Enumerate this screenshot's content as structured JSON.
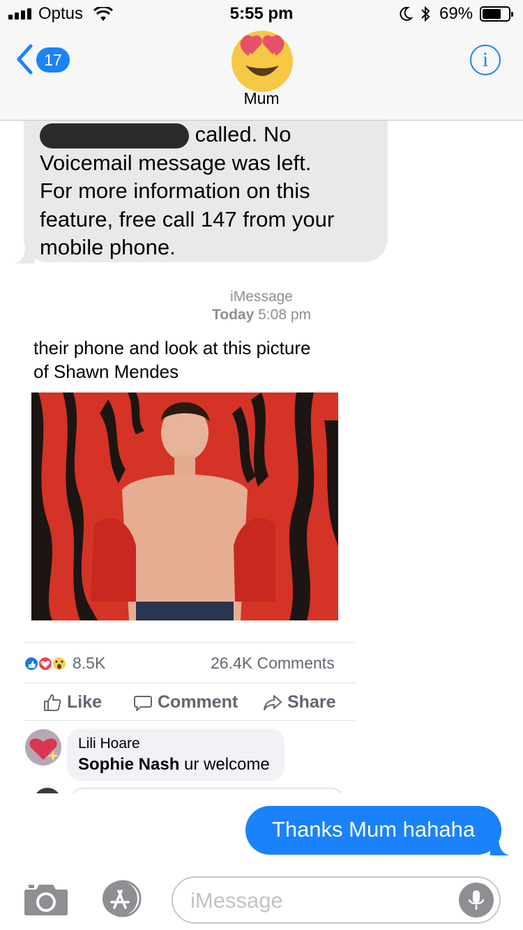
{
  "status_bar": {
    "carrier": "Optus",
    "time": "5:55 pm",
    "battery_percent": "69%",
    "icons": [
      "signal-icon",
      "wifi-icon",
      "moon-icon",
      "bluetooth-icon",
      "battery-icon"
    ]
  },
  "header": {
    "back_count": "17",
    "contact_name": "Mum",
    "contact_avatar": "heart-eyes-emoji",
    "info_label": "i"
  },
  "conversation": {
    "incoming_message": {
      "line1_suffix": "called. No",
      "line2": "Voicemail message was left.",
      "line3": "For more information on this",
      "line4": "feature, free call 147 from your",
      "line5": "mobile phone."
    },
    "divider": {
      "service": "iMessage",
      "day": "Today",
      "time": "5:08 pm"
    },
    "screenshot_post": {
      "text_line1": "their phone and look at this picture",
      "text_line2": "of Shawn Mendes",
      "reactions_count": "8.5K",
      "comments_count": "26.4K Comments",
      "actions": {
        "like": "Like",
        "comment": "Comment",
        "share": "Share"
      },
      "comment": {
        "author": "Lili Hoare",
        "tagged_name": "Sophie Nash",
        "text": " ur welcome"
      }
    },
    "outgoing_message": "Thanks Mum hahaha"
  },
  "input_bar": {
    "placeholder": "iMessage"
  },
  "colors": {
    "imessage_blue": "#1a82fb",
    "incoming_bubble": "#e9e9eb",
    "header_bg": "#f7f7f7",
    "fb_gray": "#606770"
  }
}
